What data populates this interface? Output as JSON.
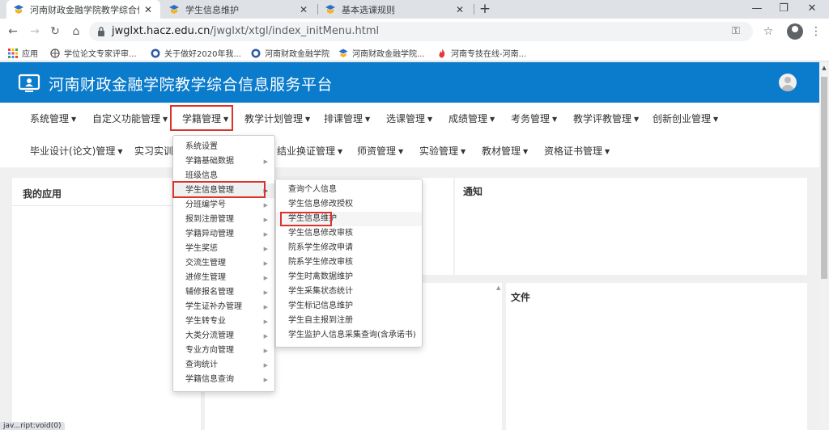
{
  "browser": {
    "tabs": [
      {
        "title": "河南财政金融学院教学综合信息服"
      },
      {
        "title": "学生信息维护"
      },
      {
        "title": "基本选课规则"
      }
    ],
    "url_host": "jwglxt.hacz.edu.cn",
    "url_path": "/jwglxt/xtgl/index_initMenu.html",
    "bookmarks": [
      {
        "label": "应用"
      },
      {
        "label": "学位论文专家评审..."
      },
      {
        "label": "关于做好2020年我..."
      },
      {
        "label": "河南财政金融学院"
      },
      {
        "label": "河南财政金融学院..."
      },
      {
        "label": "河南专技在线-河南..."
      }
    ]
  },
  "site": {
    "title": "河南财政金融学院教学综合信息服务平台"
  },
  "nav": {
    "row1": [
      "系统管理",
      "自定义功能管理",
      "学籍管理",
      "教学计划管理",
      "排课管理",
      "选课管理",
      "成绩管理",
      "考务管理",
      "教学评教管理",
      "创新创业管理"
    ],
    "row2": [
      "毕业设计(论文)管理",
      "实习实训",
      "结业换证管理",
      "师资管理",
      "实验管理",
      "教材管理",
      "资格证书管理"
    ]
  },
  "panels": {
    "my_apps": "我的应用",
    "notice": "通知",
    "files": "文件"
  },
  "menu1": {
    "items": [
      {
        "label": "系统设置",
        "sub": false
      },
      {
        "label": "学籍基础数据",
        "sub": true
      },
      {
        "label": "班级信息",
        "sub": false
      },
      {
        "label": "学生信息管理",
        "sub": true
      },
      {
        "label": "分班编学号",
        "sub": true
      },
      {
        "label": "报到注册管理",
        "sub": true
      },
      {
        "label": "学籍异动管理",
        "sub": true
      },
      {
        "label": "学生奖惩",
        "sub": true
      },
      {
        "label": "交流生管理",
        "sub": true
      },
      {
        "label": "进修生管理",
        "sub": true
      },
      {
        "label": "辅修报名管理",
        "sub": true
      },
      {
        "label": "学生证补办管理",
        "sub": true
      },
      {
        "label": "学生转专业",
        "sub": true
      },
      {
        "label": "大类分流管理",
        "sub": true
      },
      {
        "label": "专业方向管理",
        "sub": true
      },
      {
        "label": "查询统计",
        "sub": true
      },
      {
        "label": "学籍信息查询",
        "sub": true
      }
    ]
  },
  "menu2": {
    "items": [
      {
        "label": "查询个人信息"
      },
      {
        "label": "学生信息修改授权"
      },
      {
        "label": "学生信息维护"
      },
      {
        "label": "学生信息修改审核"
      },
      {
        "label": "院系学生修改申请"
      },
      {
        "label": "院系学生修改审核"
      },
      {
        "label": "学生时禽数据维护"
      },
      {
        "label": "学生采集状态统计"
      },
      {
        "label": "学生标记信息维护"
      },
      {
        "label": "学生自主报到注册"
      },
      {
        "label": "学生监护人信息采集查询(含承诺书)"
      }
    ]
  },
  "status": "jav...ript:void(0)",
  "colors": {
    "header": "#0b7bcc",
    "highlight": "#d9332c"
  }
}
